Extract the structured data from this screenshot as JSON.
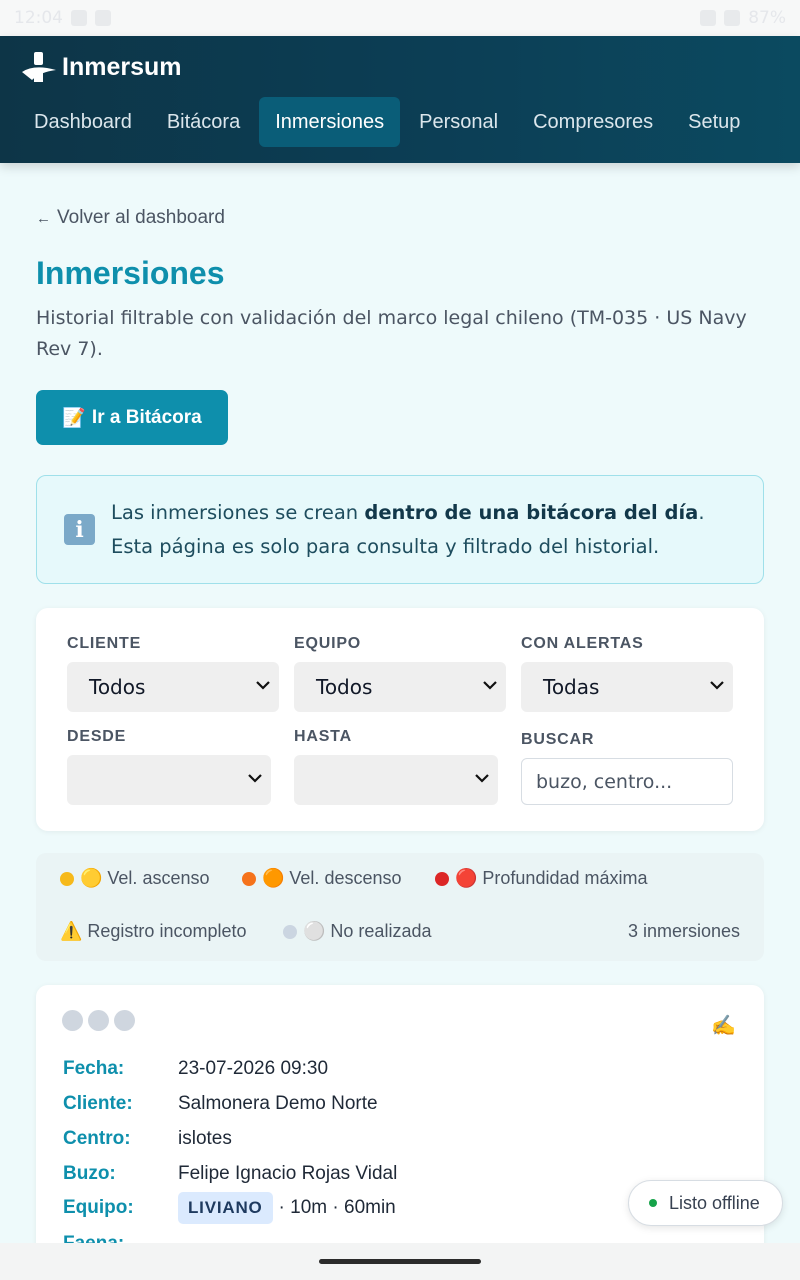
{
  "status_bar": {
    "time": "12:04",
    "battery": "87%"
  },
  "brand": {
    "name": "Inmersum"
  },
  "nav": {
    "tabs": [
      {
        "label": "Dashboard",
        "active": false
      },
      {
        "label": "Bitácora",
        "active": false
      },
      {
        "label": "Inmersiones",
        "active": true
      },
      {
        "label": "Personal",
        "active": false
      },
      {
        "label": "Compresores",
        "active": false
      },
      {
        "label": "Setup",
        "active": false
      }
    ]
  },
  "page": {
    "back_link": "Volver al dashboard",
    "back_arrow": "←",
    "title": "Inmersiones",
    "subtitle": "Historial filtrable con validación del marco legal chileno (TM-035 · US Navy Rev 7).",
    "primary_button": {
      "icon": "📝",
      "label": "Ir a Bitácora"
    }
  },
  "info": {
    "icon": "info-icon",
    "text_before": "Las inmersiones se crean ",
    "text_bold": "dentro de una bitácora del día",
    "text_after": ". Esta página es solo para consulta y filtrado del historial."
  },
  "filters": {
    "cliente": {
      "label": "CLIENTE",
      "value": "Todos"
    },
    "equipo": {
      "label": "EQUIPO",
      "value": "Todos"
    },
    "alertas": {
      "label": "CON ALERTAS",
      "value": "Todas"
    },
    "desde": {
      "label": "DESDE",
      "value": ""
    },
    "hasta": {
      "label": "HASTA",
      "value": ""
    },
    "buscar": {
      "label": "BUSCAR",
      "placeholder": "buzo, centro..."
    }
  },
  "legend": {
    "items": [
      {
        "label": "🟡 Vel. ascenso",
        "color": "#f6b91a"
      },
      {
        "label": "🟠 Vel. descenso",
        "color": "#f5721b"
      },
      {
        "label": "🔴 Profundidad máxima",
        "color": "#dc2626"
      },
      {
        "label": "⚠️ Registro incompleto",
        "color": "#f6b91a"
      },
      {
        "label": "⚪ No realizada",
        "color": "#cbd5e1"
      }
    ],
    "count": "3 inmersiones"
  },
  "card": {
    "rows": [
      {
        "label": "Fecha:",
        "value": "23-07-2026 09:30"
      },
      {
        "label": "Cliente:",
        "value": "Salmonera Demo Norte"
      },
      {
        "label": "Centro:",
        "value": "islotes"
      },
      {
        "label": "Buzo:",
        "value": "Felipe Ignacio Rojas Vidal"
      },
      {
        "label": "Equipo:",
        "value": "· 10m · 60min",
        "pill": "LIVIANO"
      },
      {
        "label": "Faena:",
        "value": ""
      }
    ]
  },
  "offline_badge": {
    "label": "Listo offline"
  },
  "colors": {
    "accent": "#0e8fac",
    "header": "#0d3547",
    "active_tab": "#0a5d78"
  }
}
